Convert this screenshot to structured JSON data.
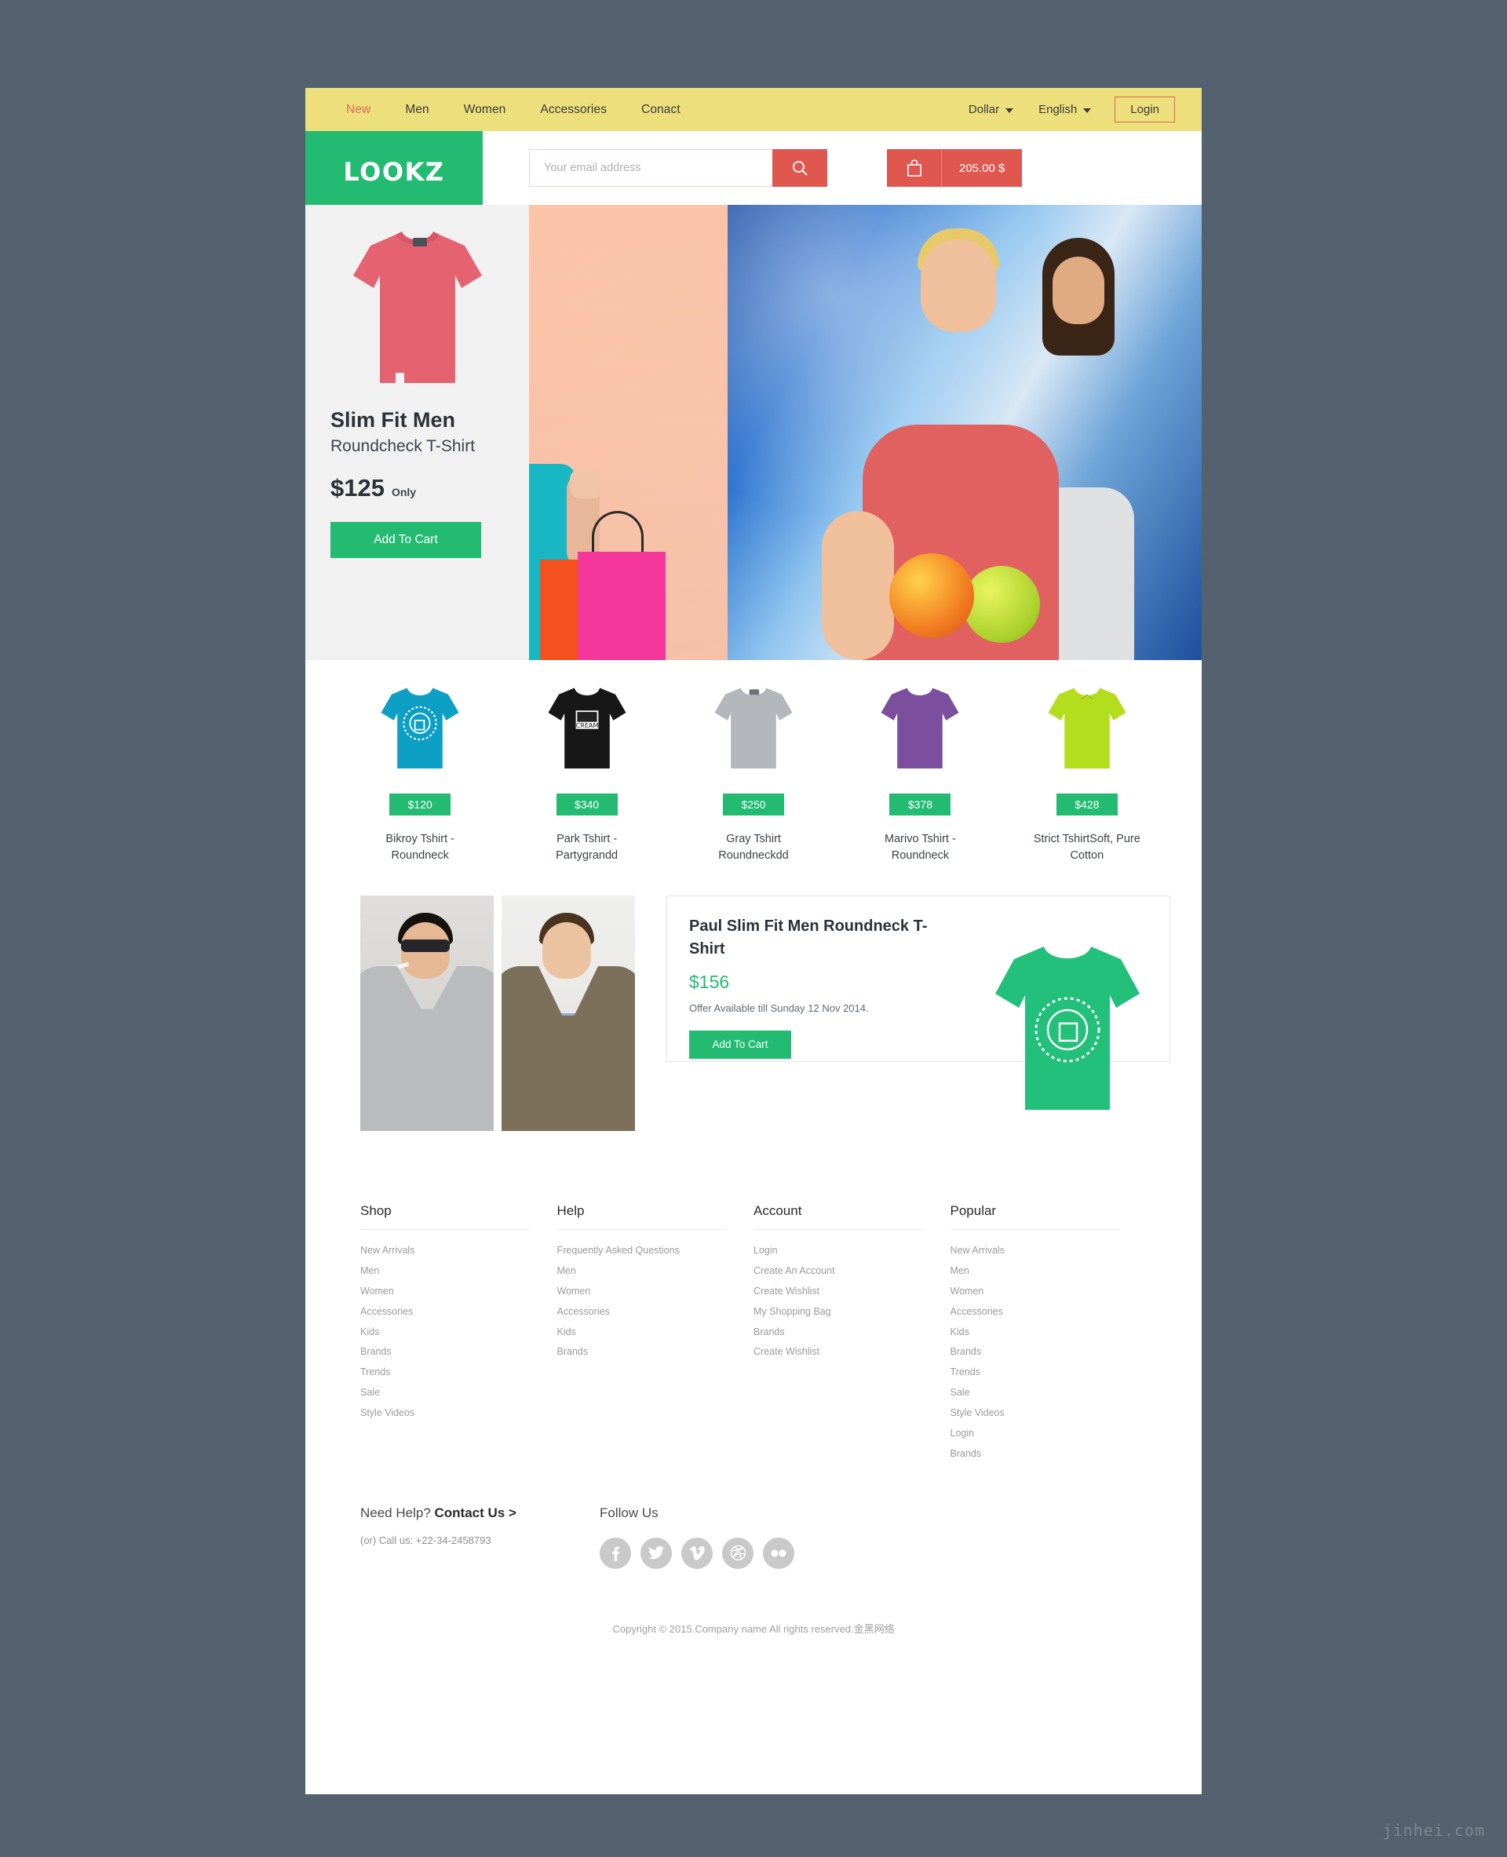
{
  "topbar": {
    "nav": [
      {
        "label": "New",
        "active": true
      },
      {
        "label": "Men",
        "active": false
      },
      {
        "label": "Women",
        "active": false
      },
      {
        "label": "Accessories",
        "active": false
      },
      {
        "label": "Conact",
        "active": false
      }
    ],
    "currency": "Dollar",
    "language": "English",
    "login_label": "Login"
  },
  "header": {
    "logo": "LOOKZ",
    "search_placeholder": "Your email address",
    "search_value": "",
    "search_icon": "search-icon",
    "cart_icon": "shopping-bag-icon",
    "cart_total": "205.00 $"
  },
  "hero": {
    "title": "Slim Fit Men",
    "subtitle": "Roundcheck T-Shirt",
    "price": "$125",
    "price_note": "Only",
    "cta": "Add To Cart"
  },
  "products": [
    {
      "name": "Bikroy Tshirt - Roundneck",
      "price": "$120",
      "color": "#0e9fc4",
      "print": "circle"
    },
    {
      "name": "Park Tshirt - Partygrandd",
      "price": "$340",
      "color": "#171717",
      "print": "square"
    },
    {
      "name": "Gray Tshirt Roundneckdd",
      "price": "$250",
      "color": "#b4b7bb",
      "print": "none"
    },
    {
      "name": "Marivo Tshirt - Roundneck",
      "price": "$378",
      "color": "#7b4f9e",
      "print": "none"
    },
    {
      "name": "Strict TshirtSoft, Pure Cotton",
      "price": "$428",
      "color": "#b4dd1e",
      "print": "none"
    }
  ],
  "promo": {
    "title": "Paul Slim Fit Men Roundneck T-Shirt",
    "price": "$156",
    "offer": "Offer Available till Sunday 12 Nov 2014.",
    "cta": "Add To Cart",
    "shirt_color": "#23bb72"
  },
  "footer": {
    "columns": [
      {
        "heading": "Shop",
        "links": [
          "New Arrivals",
          "Men",
          "Women",
          "Accessories",
          "Kids",
          "Brands",
          "Trends",
          "Sale",
          "Style Videos"
        ]
      },
      {
        "heading": "Help",
        "links": [
          "Frequently Asked Questions",
          "Men",
          "Women",
          "Accessories",
          "Kids",
          "Brands"
        ]
      },
      {
        "heading": "Account",
        "links": [
          "Login",
          "Create An Account",
          "Create Wishlist",
          "My Shopping Bag",
          "Brands",
          "Create Wishlist"
        ]
      },
      {
        "heading": "Popular",
        "links": [
          "New Arrivals",
          "Men",
          "Women",
          "Accessories",
          "Kids",
          "Brands",
          "Trends",
          "Sale",
          "Style Videos",
          "Login",
          "Brands"
        ]
      }
    ],
    "need_help_prefix": "Need Help?",
    "need_help_link": "Contact Us >",
    "call_us": "(or) Call us: +22-34-2458793",
    "follow_heading": "Follow Us",
    "socials": [
      "facebook-icon",
      "twitter-icon",
      "vimeo-icon",
      "dribbble-icon",
      "flickr-icon"
    ],
    "social_glyphs": [
      "f",
      "t",
      "v",
      "d",
      "fl"
    ],
    "copyright": "Copyright © 2015.Company name All rights reserved.金黑网络"
  },
  "watermark": "jinhei.com",
  "colors": {
    "topbar": "#ecdf7c",
    "brand_green": "#23bb72",
    "accent_red": "#e0574f",
    "page_bg": "#54616e"
  }
}
